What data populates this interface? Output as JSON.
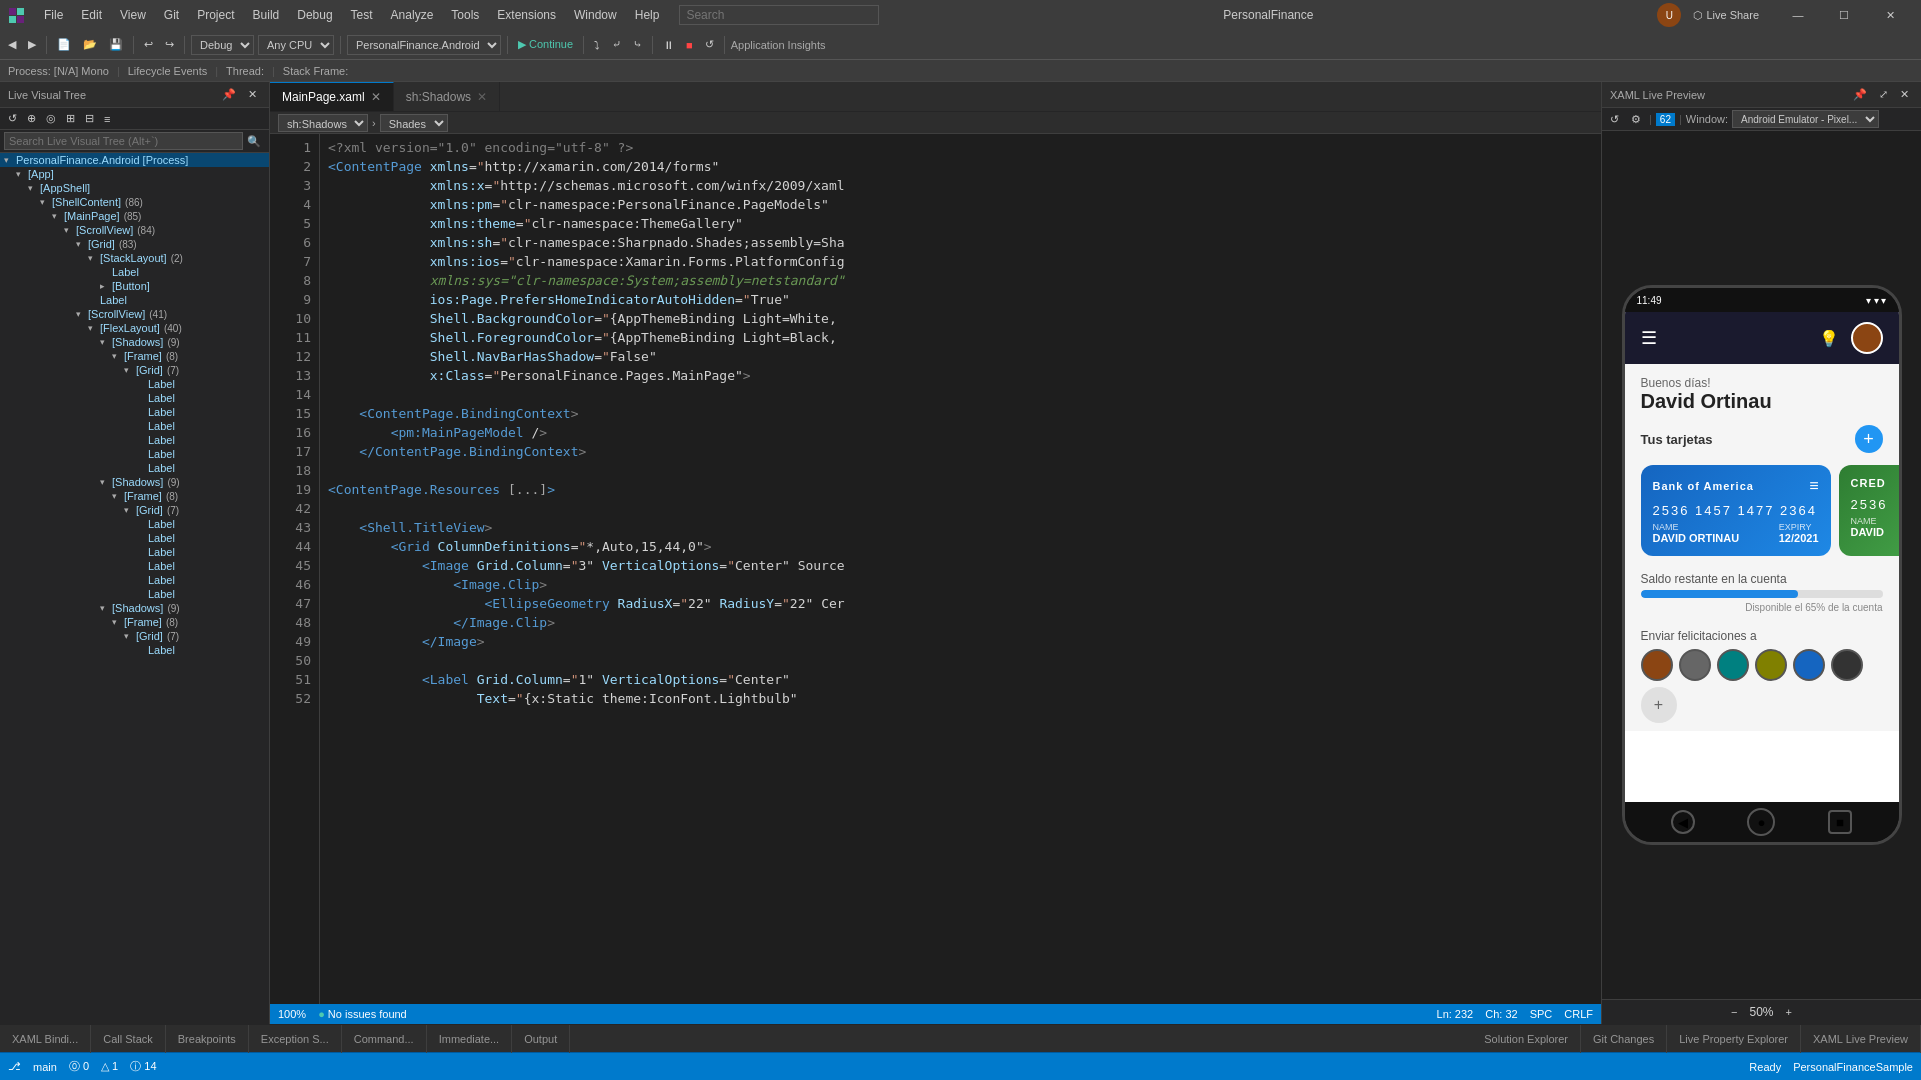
{
  "titleBar": {
    "appName": "PersonalFinance",
    "menuItems": [
      "File",
      "Edit",
      "View",
      "Git",
      "Project",
      "Build",
      "Debug",
      "Test",
      "Analyze",
      "Tools",
      "Extensions",
      "Window",
      "Help"
    ],
    "searchPlaceholder": "Search",
    "windowControls": [
      "—",
      "☐",
      "✕"
    ]
  },
  "toolbar": {
    "debugConfig": "Debug",
    "cpuConfig": "Any CPU",
    "project": "PersonalFinance.Android",
    "continueLabel": "Continue",
    "liveShare": "Live Share",
    "applicationInsights": "Application Insights"
  },
  "processBar": {
    "process": "Process: [N/A] Mono",
    "lifecycle": "Lifecycle Events",
    "thread": "Thread:",
    "stackFrame": "Stack Frame:"
  },
  "liveTree": {
    "title": "Live Visual Tree",
    "searchPlaceholder": "Search Live Visual Tree (Alt+`)",
    "items": [
      {
        "label": "PersonalFinance.Android [Process]",
        "indent": 0,
        "expanded": true,
        "count": ""
      },
      {
        "label": "[App]",
        "indent": 1,
        "expanded": true,
        "count": ""
      },
      {
        "label": "[AppShell]",
        "indent": 2,
        "expanded": true,
        "count": ""
      },
      {
        "label": "[ShellContent]",
        "indent": 3,
        "expanded": true,
        "count": "86"
      },
      {
        "label": "[MainPage]",
        "indent": 4,
        "expanded": true,
        "count": "85"
      },
      {
        "label": "[ScrollView]",
        "indent": 5,
        "expanded": true,
        "count": "84"
      },
      {
        "label": "[Grid]",
        "indent": 6,
        "expanded": true,
        "count": "83"
      },
      {
        "label": "[StackLayout]",
        "indent": 7,
        "expanded": true,
        "count": "2"
      },
      {
        "label": "Label",
        "indent": 8,
        "expanded": false,
        "count": ""
      },
      {
        "label": "[Button]",
        "indent": 8,
        "expanded": false,
        "count": ""
      },
      {
        "label": "Label",
        "indent": 7,
        "expanded": false,
        "count": ""
      },
      {
        "label": "[ScrollView]",
        "indent": 6,
        "expanded": true,
        "count": "41"
      },
      {
        "label": "[FlexLayout]",
        "indent": 7,
        "expanded": true,
        "count": "40"
      },
      {
        "label": "[Shadows]",
        "indent": 8,
        "expanded": true,
        "count": "9"
      },
      {
        "label": "[Frame]",
        "indent": 9,
        "expanded": true,
        "count": "8"
      },
      {
        "label": "[Grid]",
        "indent": 10,
        "expanded": true,
        "count": "7"
      },
      {
        "label": "Label",
        "indent": 11,
        "expanded": false,
        "count": ""
      },
      {
        "label": "Label",
        "indent": 11,
        "expanded": false,
        "count": ""
      },
      {
        "label": "Label",
        "indent": 11,
        "expanded": false,
        "count": ""
      },
      {
        "label": "Label",
        "indent": 11,
        "expanded": false,
        "count": ""
      },
      {
        "label": "Label",
        "indent": 11,
        "expanded": false,
        "count": ""
      },
      {
        "label": "Label",
        "indent": 11,
        "expanded": false,
        "count": ""
      },
      {
        "label": "Label",
        "indent": 11,
        "expanded": false,
        "count": ""
      },
      {
        "label": "[Shadows]",
        "indent": 8,
        "expanded": true,
        "count": "9"
      },
      {
        "label": "[Frame]",
        "indent": 9,
        "expanded": true,
        "count": "8"
      },
      {
        "label": "[Grid]",
        "indent": 10,
        "expanded": true,
        "count": "7"
      },
      {
        "label": "Label",
        "indent": 11,
        "expanded": false,
        "count": ""
      },
      {
        "label": "Label",
        "indent": 11,
        "expanded": false,
        "count": ""
      },
      {
        "label": "Label",
        "indent": 11,
        "expanded": false,
        "count": ""
      },
      {
        "label": "Label",
        "indent": 11,
        "expanded": false,
        "count": ""
      },
      {
        "label": "Label",
        "indent": 11,
        "expanded": false,
        "count": ""
      },
      {
        "label": "Label",
        "indent": 11,
        "expanded": false,
        "count": ""
      },
      {
        "label": "[Shadows]",
        "indent": 8,
        "expanded": true,
        "count": "9"
      },
      {
        "label": "[Frame]",
        "indent": 9,
        "expanded": true,
        "count": "8"
      },
      {
        "label": "[Grid]",
        "indent": 10,
        "expanded": true,
        "count": "7"
      },
      {
        "label": "Label",
        "indent": 11,
        "expanded": false,
        "count": ""
      }
    ]
  },
  "editorTabs": [
    {
      "label": "MainPage.xaml",
      "active": true,
      "modified": false
    },
    {
      "label": "sh:Shadows",
      "active": false,
      "modified": false
    }
  ],
  "editorToolbar": {
    "dropdown1": "sh:Shadows",
    "dropdown2": "Shades"
  },
  "codeLines": [
    {
      "num": 1,
      "content": "<?xml version=\"1.0\" encoding=\"utf-8\" ?>",
      "type": "pi"
    },
    {
      "num": 2,
      "content": "<ContentPage xmlns=\"http://xamarin.com/2014/forms\"",
      "type": "tag"
    },
    {
      "num": 3,
      "content": "             xmlns:x=\"http://schemas.microsoft.com/winfx/2009/xaml",
      "type": "attr"
    },
    {
      "num": 4,
      "content": "             xmlns:pm=\"clr-namespace:PersonalFinance.PageModels\"",
      "type": "attr"
    },
    {
      "num": 5,
      "content": "             xmlns:theme=\"clr-namespace:ThemeGallery\"",
      "type": "attr"
    },
    {
      "num": 6,
      "content": "             xmlns:sh=\"clr-namespace:Sharpnado.Shades;assembly=Sha",
      "type": "attr"
    },
    {
      "num": 7,
      "content": "             xmlns:ios=\"clr-namespace:Xamarin.Forms.PlatformConfig",
      "type": "attr"
    },
    {
      "num": 8,
      "content": "             xmlns:sys=\"clr-namespace:System;assembly=netstandard\"",
      "type": "comment"
    },
    {
      "num": 9,
      "content": "             ios:Page.PrefersHomeIndicatorAutoHidden=\"True\"",
      "type": "attr"
    },
    {
      "num": 10,
      "content": "             Shell.BackgroundColor=\"{AppThemeBinding Light=White,",
      "type": "attr"
    },
    {
      "num": 11,
      "content": "             Shell.ForegroundColor=\"{AppThemeBinding Light=Black,",
      "type": "attr"
    },
    {
      "num": 12,
      "content": "             Shell.NavBarHasShadow=\"False\"",
      "type": "attr"
    },
    {
      "num": 13,
      "content": "             x:Class=\"PersonalFinance.Pages.MainPage\">",
      "type": "tag"
    },
    {
      "num": 14,
      "content": "",
      "type": "empty"
    },
    {
      "num": 15,
      "content": "    <ContentPage.BindingContext>",
      "type": "tag"
    },
    {
      "num": 16,
      "content": "        <pm:MainPageModel />",
      "type": "tag"
    },
    {
      "num": 17,
      "content": "    </ContentPage.BindingContext>",
      "type": "tag"
    },
    {
      "num": 18,
      "content": "",
      "type": "empty"
    },
    {
      "num": 19,
      "content": "    <ContentPage.Resources [...] >",
      "type": "collapsed"
    },
    {
      "num": 42,
      "content": "",
      "type": "empty"
    },
    {
      "num": 43,
      "content": "    <Shell.TitleView>",
      "type": "tag"
    },
    {
      "num": 44,
      "content": "        <Grid ColumnDefinitions=\"*,Auto,15,44,0\">",
      "type": "tag"
    },
    {
      "num": 45,
      "content": "            <Image Grid.Column=\"3\" VerticalOptions=\"Center\" Source",
      "type": "tag"
    },
    {
      "num": 46,
      "content": "                <Image.Clip>",
      "type": "tag"
    },
    {
      "num": 47,
      "content": "                    <EllipseGeometry RadiusX=\"22\" RadiusY=\"22\" Cer",
      "type": "tag"
    },
    {
      "num": 48,
      "content": "                </Image.Clip>",
      "type": "tag"
    },
    {
      "num": 49,
      "content": "            </Image>",
      "type": "tag"
    },
    {
      "num": 50,
      "content": "",
      "type": "empty"
    },
    {
      "num": 51,
      "content": "            <Label Grid.Column=\"1\" VerticalOptions=\"Center\"",
      "type": "tag"
    },
    {
      "num": 52,
      "content": "                   Text=\"{x:Static theme:IconFont.Lightbulb\"",
      "type": "attr"
    }
  ],
  "editorStatus": {
    "zoom": "100%",
    "noIssues": "No issues found",
    "ln": "Ln: 232",
    "ch": "Ch: 32",
    "spc": "SPC",
    "encoding": "CRLF"
  },
  "xamlPreview": {
    "title": "XAML Live Preview",
    "lineIndicator": "62",
    "windowLabel": "Window:",
    "emulatorLabel": "Android Emulator - Pixel...",
    "zoomLevel": "50%"
  },
  "phoneApp": {
    "statusTime": "11:49",
    "greeting": "Buenos días!",
    "userName": "David Ortinau",
    "sectionCards": "Tus tarjetas",
    "card1Bank": "Bank of America",
    "card1Number": "2536 1457 1477 2364",
    "card1NameLabel": "NAME",
    "card1Name": "DAVID ORTINAU",
    "card1ExpiryLabel": "EXPIRY",
    "card1Expiry": "12/2021",
    "card2Bank": "CRED",
    "card2Number": "2536",
    "card2NameLabel": "NAME",
    "card2Name": "DAVID",
    "balanceLabel": "Saldo restante en la cuenta",
    "balancePercent": 65,
    "balanceAvailable": "Disponible el 65% de la cuenta",
    "sendLabel": "Enviar felicitaciones a"
  },
  "bottomTabs": [
    {
      "label": "XAML Bindi...",
      "active": false
    },
    {
      "label": "Call Stack",
      "active": false
    },
    {
      "label": "Breakpoints",
      "active": false
    },
    {
      "label": "Exception S...",
      "active": false
    },
    {
      "label": "Command...",
      "active": false
    },
    {
      "label": "Immediate...",
      "active": false
    },
    {
      "label": "Output",
      "active": false
    }
  ],
  "bottomStatusRight": [
    {
      "label": "Solution Explorer"
    },
    {
      "label": "Git Changes"
    },
    {
      "label": "Live Property Explorer"
    },
    {
      "label": "XAML Live Preview"
    }
  ],
  "statusBar": {
    "readyLabel": "Ready",
    "errors": "⓪ 0",
    "warnings": "△ 1",
    "info": "⓪ 14",
    "branch": "main",
    "repo": "PersonalFinanceSample"
  }
}
